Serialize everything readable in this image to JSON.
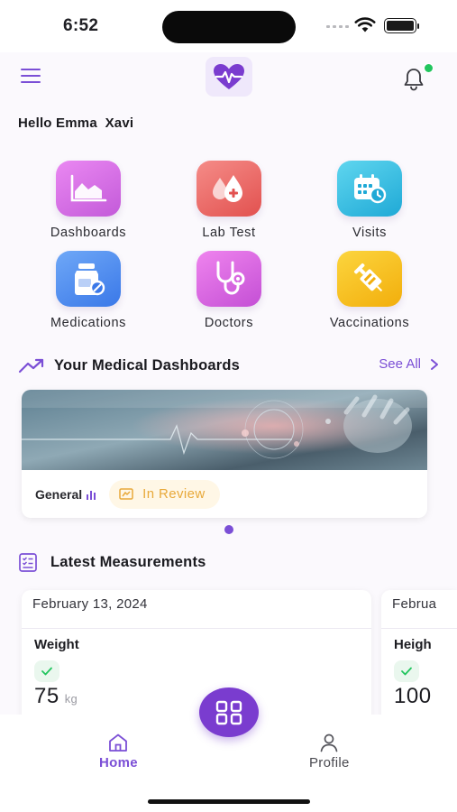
{
  "status_bar": {
    "time": "6:52"
  },
  "header": {
    "menu_icon": "hamburger-menu-icon",
    "logo_icon": "heart-pulse-icon",
    "notification_icon": "bell-icon",
    "notification_dot_color": "#22c55e"
  },
  "greeting": "Hello Emma  Xavi",
  "quick_actions": [
    {
      "label": "Dashboards",
      "icon": "area-chart-icon",
      "color": "#d56be4"
    },
    {
      "label": "Lab Test",
      "icon": "blood-drop-icon",
      "color": "#ef6a6a"
    },
    {
      "label": "Visits",
      "icon": "calendar-clock-icon",
      "color": "#33bfe0"
    },
    {
      "label": "Medications",
      "icon": "pill-bottle-icon",
      "color": "#4d8ff0"
    },
    {
      "label": "Doctors",
      "icon": "stethoscope-icon",
      "color": "#d262dc"
    },
    {
      "label": "Vaccinations",
      "icon": "syringe-icon",
      "color": "#f6be17"
    }
  ],
  "dashboards_section": {
    "title": "Your Medical Dashboards",
    "see_all": "See All",
    "card": {
      "type": "General",
      "status": "In Review"
    }
  },
  "measurements_section": {
    "title": "Latest Measurements",
    "cards": [
      {
        "date": "February 13, 2024",
        "name": "Weight",
        "value": "75",
        "unit": "kg"
      },
      {
        "date": "Februa",
        "name": "Heigh",
        "value": "100",
        "unit": ""
      }
    ]
  },
  "bottom_nav": {
    "items": [
      {
        "label": "Home",
        "icon": "home-icon",
        "active": true
      },
      {
        "label": "Profile",
        "icon": "user-icon",
        "active": false
      }
    ],
    "fab_icon": "grid-icon"
  },
  "colors": {
    "accent": "#7b4fd6",
    "fab": "#7a3ccf",
    "review": "#e8a93a",
    "check": "#22c55e"
  }
}
